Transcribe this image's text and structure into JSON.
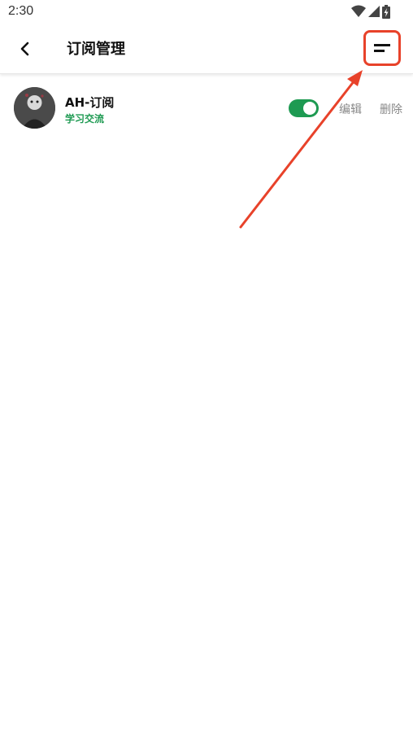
{
  "status_bar": {
    "time": "2:30",
    "icons": [
      "wifi-icon",
      "signal-icon",
      "battery-icon"
    ]
  },
  "app_bar": {
    "title": "订阅管理",
    "back_icon": "chevron-left-icon",
    "menu_icon": "menu-lines-icon"
  },
  "subscriptions": [
    {
      "name": "AH-订阅",
      "category": "学习交流",
      "enabled": true,
      "edit_label": "编辑",
      "delete_label": "删除"
    }
  ],
  "colors": {
    "accent_green": "#1e9a52",
    "annotation_red": "#e8422a",
    "secondary_text": "#888888"
  }
}
